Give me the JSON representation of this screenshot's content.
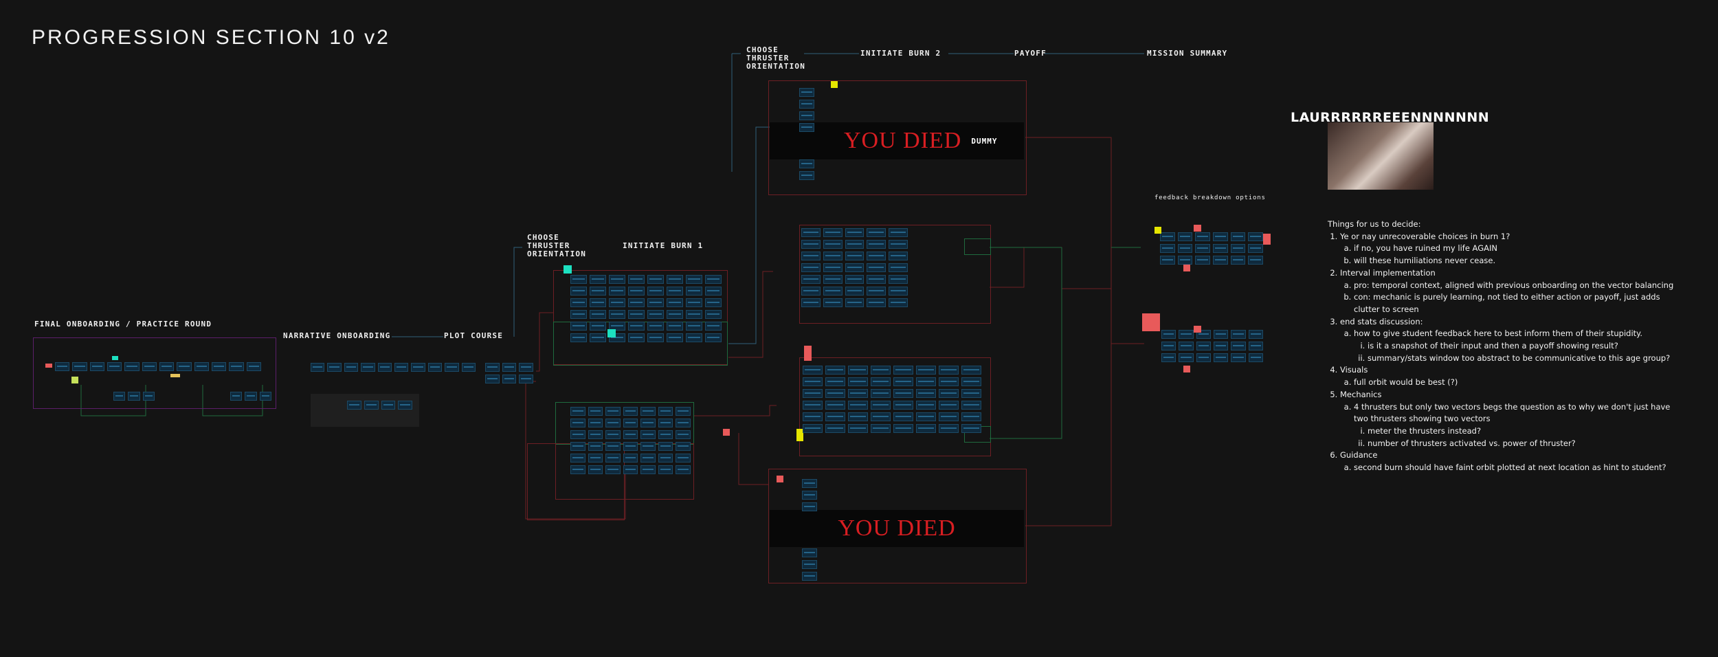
{
  "title": "PROGRESSION SECTION 10 v2",
  "stages": {
    "final_onboarding": "FINAL ONBOARDING / PRACTICE ROUND",
    "narrative_onboarding": "NARRATIVE ONBOARDING",
    "plot_course": "PLOT COURSE",
    "choose_thruster_1": "CHOOSE THRUSTER ORIENTATION",
    "initiate_burn_1": "INITIATE BURN 1",
    "choose_thruster_2": "CHOOSE THRUSTER ORIENTATION",
    "initiate_burn_2": "INITIATE BURN 2",
    "payoff": "PAYOFF",
    "mission_summary": "MISSION SUMMARY"
  },
  "you_died_top": "YOU DIED",
  "dummy_label": "DUMMY",
  "you_died_bottom": "YOU DIED",
  "meme_caption": "LAURRRRRREEENNNNNNN",
  "feedback_label": "feedback breakdown options",
  "decisions": {
    "heading": "Things for us to decide:",
    "q1": "Ye or nay unrecoverable choices in burn 1?",
    "q1a": "if no, you have ruined my life AGAIN",
    "q1b": "will these humiliations never cease.",
    "q2": "Interval implementation",
    "q2a": "pro: temporal context, aligned with previous onboarding on the vector balancing",
    "q2b": "con: mechanic is purely learning, not tied to either action or payoff, just adds clutter to screen",
    "q3": "end stats discussion:",
    "q3a": "how to give student feedback here to best inform them of their stupidity.",
    "q3ai": "is it a snapshot of their input and then a payoff showing result?",
    "q3aii": "summary/stats window too abstract to be communicative to this age group?",
    "q4": "Visuals",
    "q4a": "full orbit would be best (?)",
    "q5": "Mechanics",
    "q5a": "4 thrusters but only two vectors begs the question as to why we don't just have two thrusters showing two vectors",
    "q5ai": "meter the thrusters instead?",
    "q5aii": "number of thrusters activated vs. power of thruster?",
    "q6": "Guidance",
    "q6a": "second burn should have faint orbit plotted at next location as hint to student?"
  },
  "colors": {
    "background": "#141414",
    "connector_red": "#6e1f24",
    "connector_green": "#1f6b3e",
    "connector_blue": "#2f5f7a",
    "died_red": "#d81e22",
    "sticky_yellow": "#e6e600",
    "sticky_teal": "#1de0c0",
    "sticky_red": "#e85a5a"
  }
}
